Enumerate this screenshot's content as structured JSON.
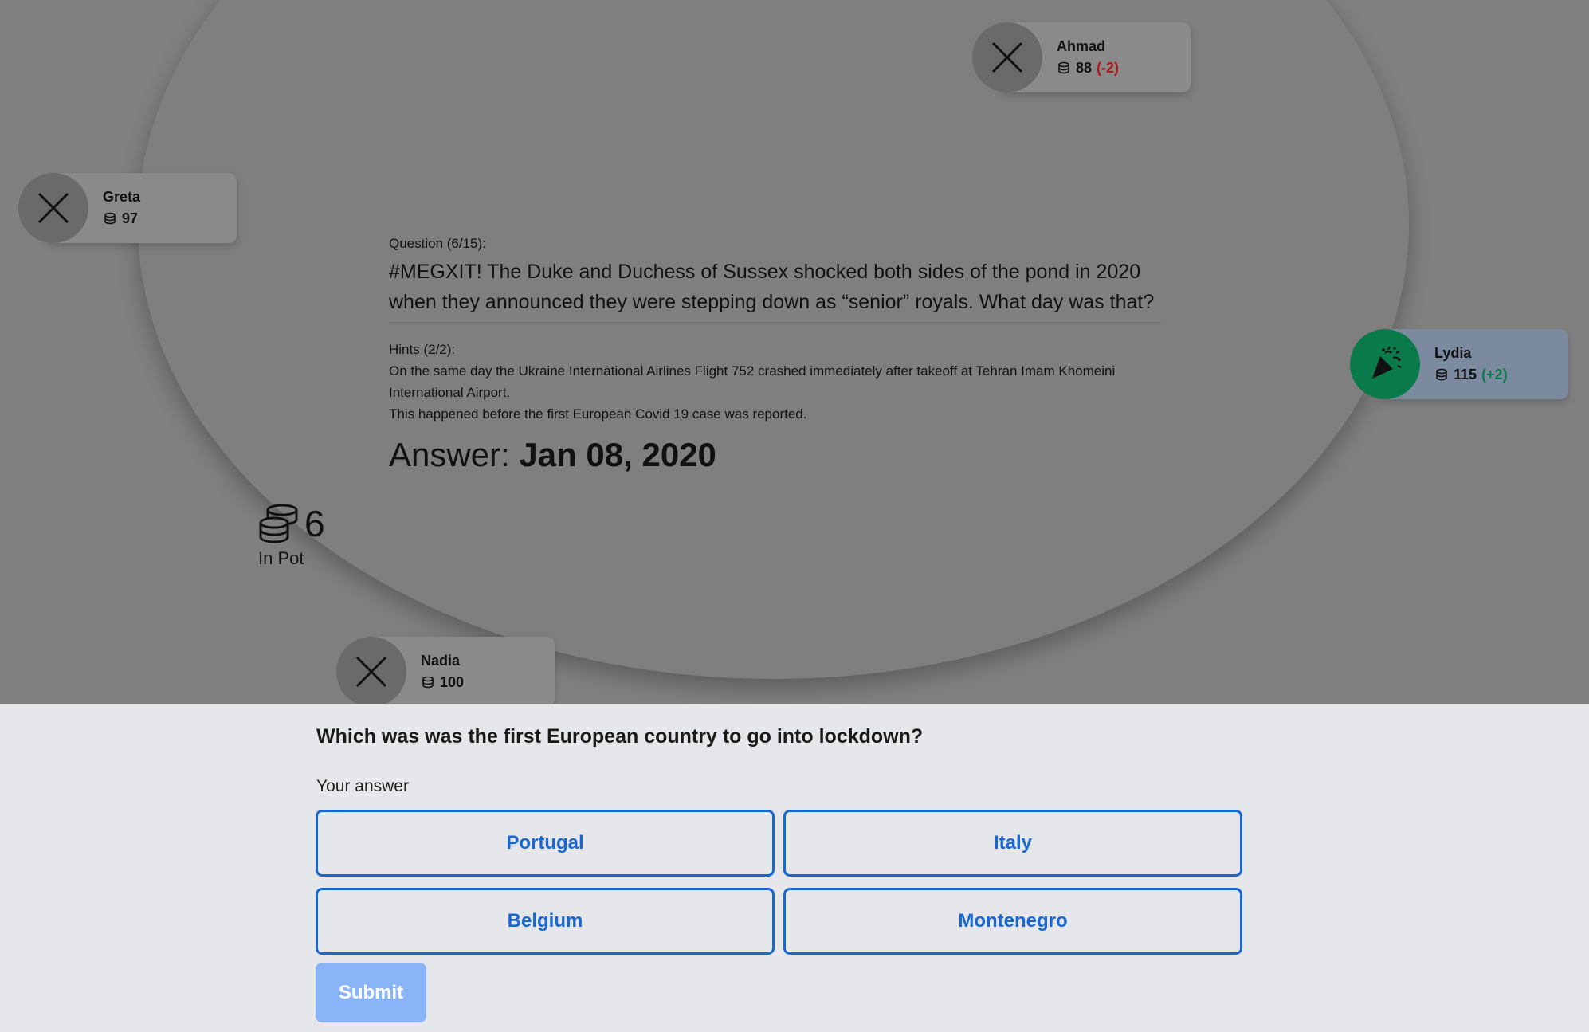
{
  "players": {
    "ahmad": {
      "name": "Ahmad",
      "chips": "88",
      "delta": "(-2)",
      "status": "x"
    },
    "greta": {
      "name": "Greta",
      "chips": "97",
      "delta": "",
      "status": "x"
    },
    "lydia": {
      "name": "Lydia",
      "chips": "115",
      "delta": "(+2)",
      "status": "winner"
    },
    "nadia": {
      "name": "Nadia",
      "chips": "100",
      "delta": "",
      "status": "x"
    }
  },
  "question": {
    "label": "Question (6/15):",
    "text": "#MEGXIT! The Duke and Duchess of Sussex shocked both sides of the pond in 2020 when they announced they were stepping down as “senior” royals. What day was that?",
    "hints_label": "Hints (2/2):",
    "hints": [
      "On the same day the Ukraine International Airlines Flight 752 crashed immediately after takeoff at Tehran Imam Khomeini International Airport.",
      "This happened before the first European Covid 19 case was reported."
    ],
    "answer_prefix": "Answer: ",
    "answer_value": "Jan 08, 2020"
  },
  "pot": {
    "amount": "6",
    "label": "In Pot"
  },
  "answer_panel": {
    "question": "Which was was the first European country to go into lockdown?",
    "your_answer_label": "Your answer",
    "options": [
      "Portugal",
      "Italy",
      "Belgium",
      "Montenegro"
    ],
    "submit_label": "Submit"
  },
  "colors": {
    "accent": "#1967d2",
    "submit_disabled": "#8ab4f8",
    "winner": "#0b7a4b",
    "negative": "#b3141b"
  },
  "icons": {
    "eliminated": "x-icon",
    "winner": "party-popper-icon",
    "chips": "coins-icon"
  }
}
